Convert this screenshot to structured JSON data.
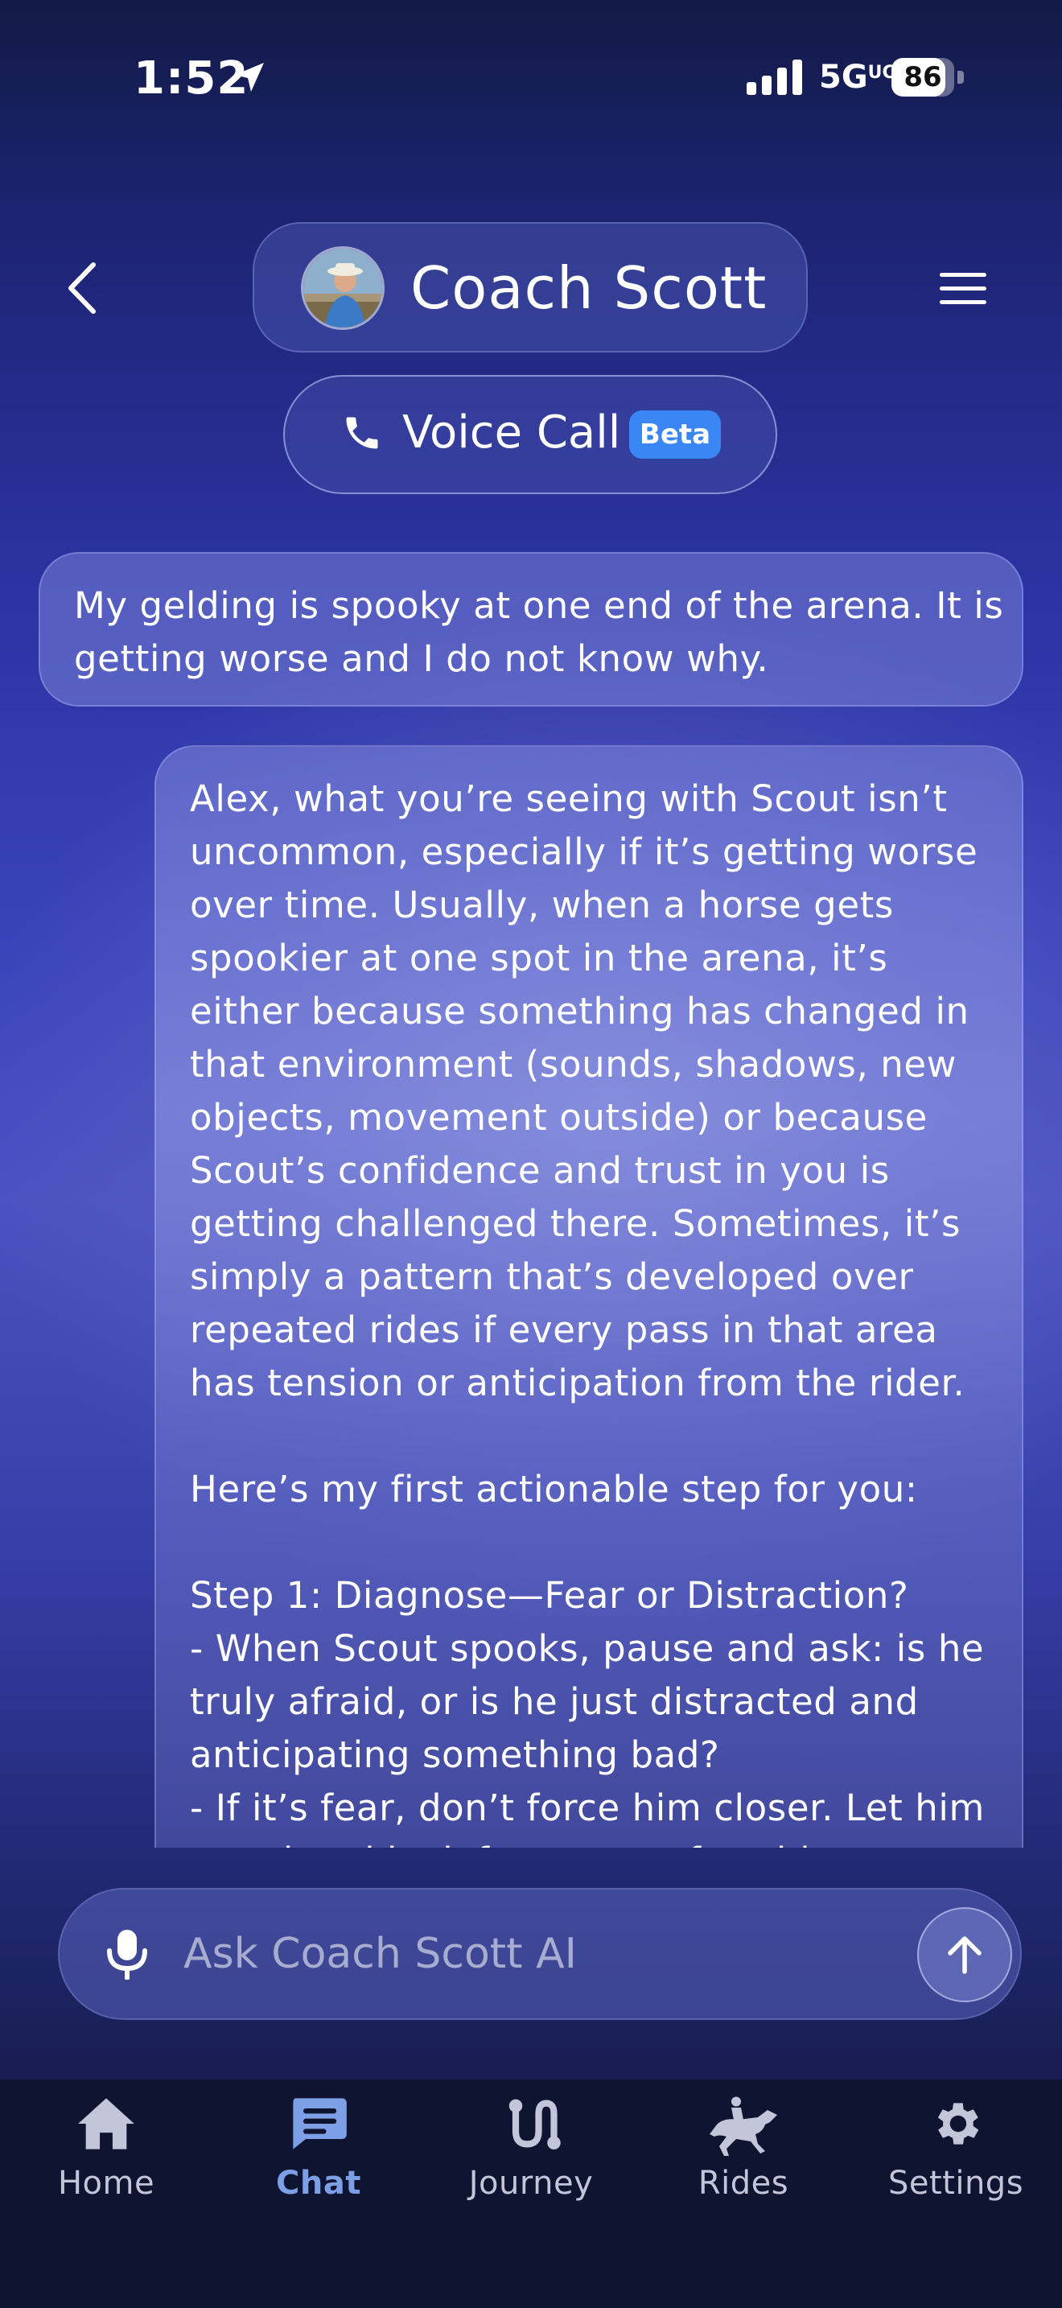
{
  "status_bar": {
    "time": "1:52",
    "network": "5G",
    "network_sup": "UC",
    "battery": "86",
    "battery_level": 0.86
  },
  "header": {
    "coach_name": "Coach Scott",
    "voice_call_label": "Voice Call",
    "beta_badge": "Beta",
    "back_icon": "chevron-left-icon",
    "menu_icon": "hamburger-menu-icon"
  },
  "chat": {
    "user_message": "My gelding is spooky at one end of the arena. It is getting worse and I do not know why.",
    "coach_paragraph_1": "Alex, what you’re seeing with Scout isn’t uncommon, especially if it’s getting worse over time. Usually, when a horse gets spookier at one spot in the arena, it’s either because something has changed in that environment (sounds, shadows, new objects, movement outside) or because Scout’s confidence and trust in you is getting challenged there. Sometimes, it’s simply a pattern that’s developed over repeated rides if every pass in that area has tension or anticipation from the rider.",
    "coach_paragraph_2": "Here’s my first actionable step for you:",
    "coach_step_title": "Step 1: Diagnose—Fear or Distraction?",
    "coach_step_bullet_1": "- When Scout spooks, pause and ask: is he truly afraid, or is he just distracted and anticipating something bad?",
    "coach_step_bullet_2": "- If it’s fear, don’t force him closer. Let him stand and look from a comfortable distance."
  },
  "composer": {
    "placeholder": "Ask Coach Scott AI",
    "value": ""
  },
  "tabs": [
    {
      "label": "Home",
      "icon": "home-icon",
      "active": false
    },
    {
      "label": "Chat",
      "icon": "chat-icon",
      "active": true
    },
    {
      "label": "Journey",
      "icon": "journey-icon",
      "active": false
    },
    {
      "label": "Rides",
      "icon": "horse-rider-icon",
      "active": false
    },
    {
      "label": "Settings",
      "icon": "gear-icon",
      "active": false
    }
  ],
  "colors": {
    "accent": "#3a86f5",
    "active_tab": "#7c9fe6",
    "tab_bar": "#0f1430"
  }
}
